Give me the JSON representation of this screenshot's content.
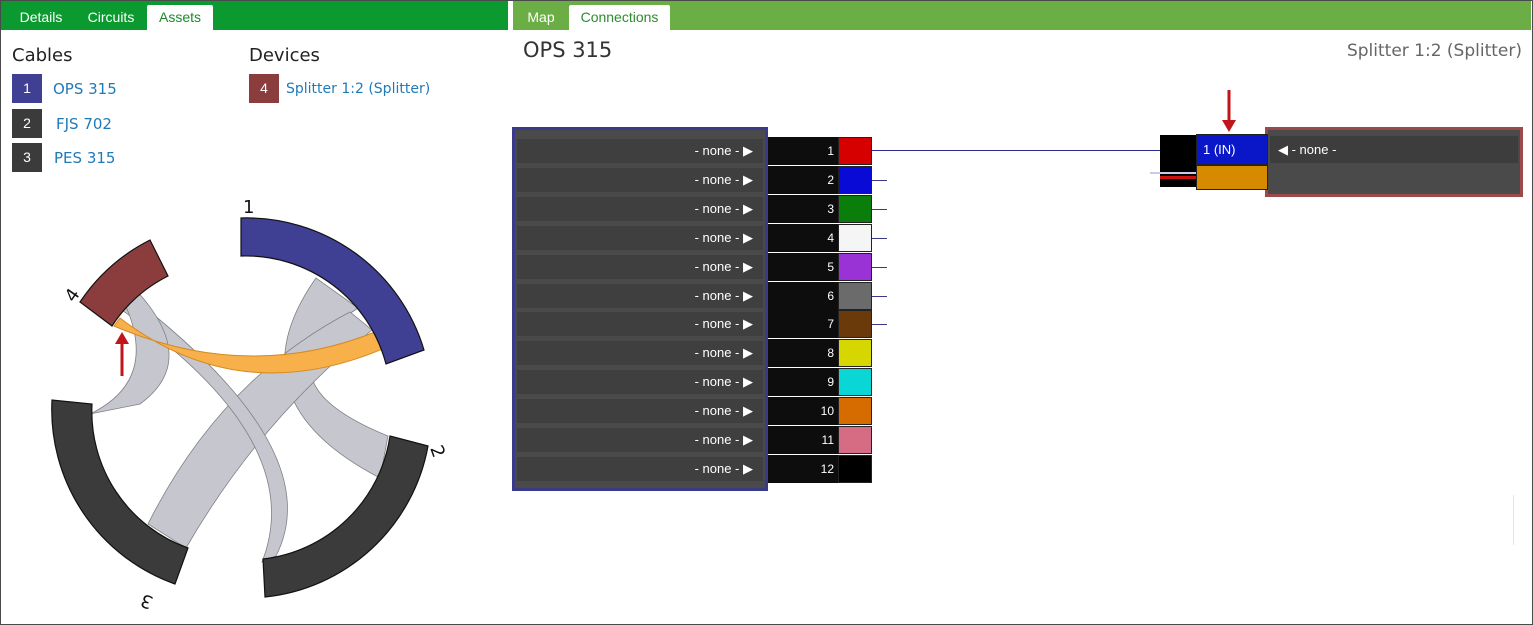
{
  "left_tabs": [
    {
      "label": "Details",
      "active": false
    },
    {
      "label": "Circuits",
      "active": false
    },
    {
      "label": "Assets",
      "active": true
    }
  ],
  "right_tabs": [
    {
      "label": "Map",
      "active": false
    },
    {
      "label": "Connections",
      "active": true
    }
  ],
  "assets": {
    "cables_heading": "Cables",
    "devices_heading": "Devices",
    "cables": [
      {
        "number": "1",
        "name": "OPS 315",
        "color": "#3f3f93"
      },
      {
        "number": "2",
        "name": "FJS 702",
        "color": "#3b3b3b"
      },
      {
        "number": "3",
        "name": "PES 315",
        "color": "#3b3b3b"
      }
    ],
    "devices": [
      {
        "number": "4",
        "name": "Splitter 1:2 (Splitter)",
        "color": "#8b3d3d"
      }
    ]
  },
  "chord": {
    "labels": [
      "1",
      "2",
      "3",
      "4"
    ],
    "colors": {
      "cable1": "#3f3f93",
      "cable2": "#3b3b3b",
      "cable3": "#3b3b3b",
      "device4": "#8b3d3d",
      "chord": "#c4c4cc",
      "highlight": "#f7b04a"
    }
  },
  "connections": {
    "cable_title": "OPS 315",
    "device_title": "Splitter 1:2 (Splitter)",
    "fibers": [
      {
        "num": "1",
        "label": "- none - ▶",
        "color": "#d60000"
      },
      {
        "num": "2",
        "label": "- none - ▶",
        "color": "#0a0ad6"
      },
      {
        "num": "3",
        "label": "- none - ▶",
        "color": "#0b7d0b"
      },
      {
        "num": "4",
        "label": "- none - ▶",
        "color": "#f5f5f5"
      },
      {
        "num": "5",
        "label": "- none - ▶",
        "color": "#9a33d6"
      },
      {
        "num": "6",
        "label": "- none - ▶",
        "color": "#6b6b6b"
      },
      {
        "num": "7",
        "label": "- none - ▶",
        "color": "#6b3a0a"
      },
      {
        "num": "8",
        "label": "- none - ▶",
        "color": "#d6d600"
      },
      {
        "num": "9",
        "label": "- none - ▶",
        "color": "#0ad6d6"
      },
      {
        "num": "10",
        "label": "- none - ▶",
        "color": "#d66b00"
      },
      {
        "num": "11",
        "label": "- none - ▶",
        "color": "#d66b84"
      },
      {
        "num": "12",
        "label": "- none - ▶",
        "color": "#000000"
      }
    ],
    "splitter_in_port": "1 (IN)",
    "splitter_none": "◀ - none -",
    "arrow_color": "#c0161b"
  }
}
